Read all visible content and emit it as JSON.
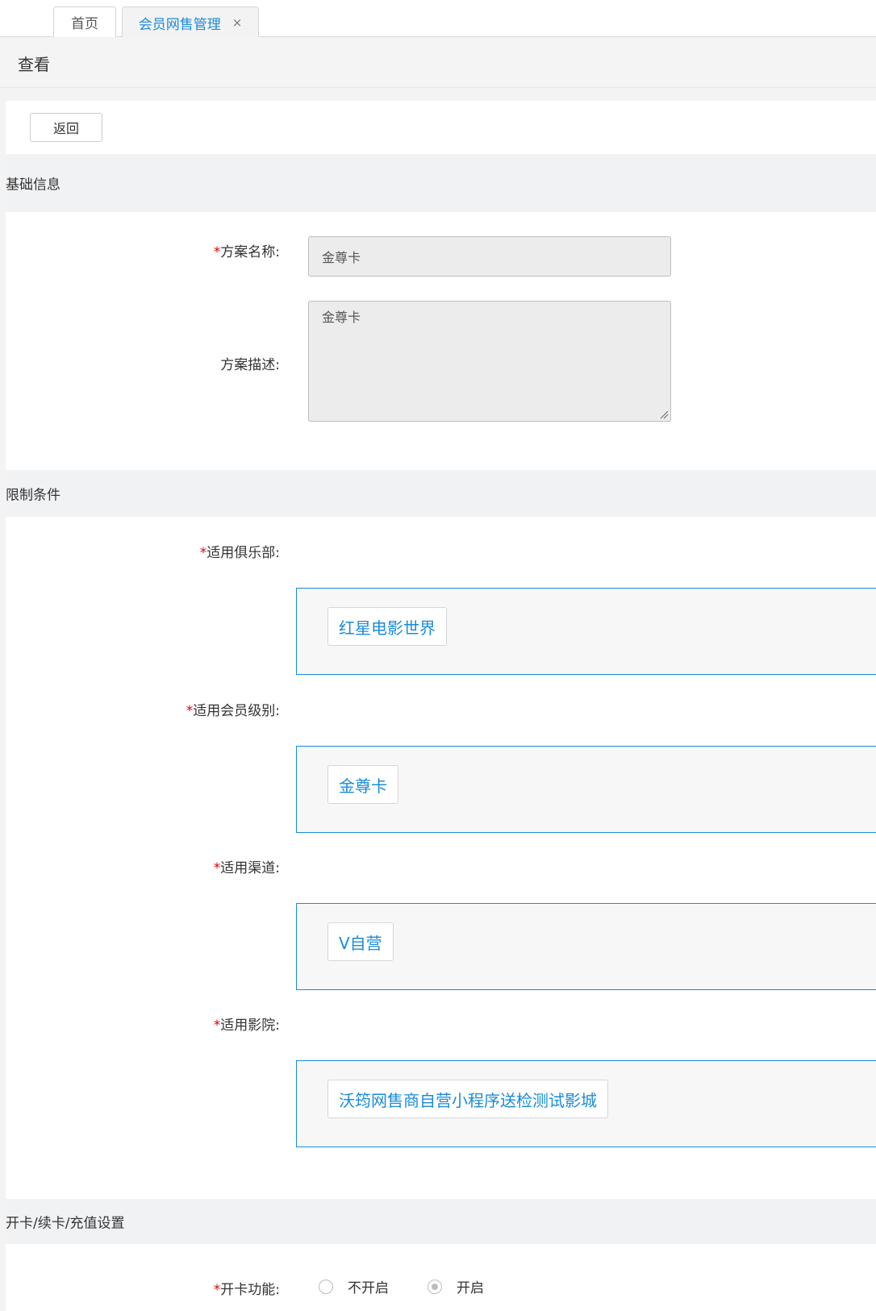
{
  "tabs": [
    {
      "label": "首页",
      "active": false
    },
    {
      "label": "会员网售管理",
      "active": true,
      "close": "×"
    }
  ],
  "page": {
    "title": "查看"
  },
  "toolbar": {
    "back_label": "返回"
  },
  "sections": {
    "basic": {
      "title": "基础信息",
      "plan_name": {
        "required_mark": "*",
        "label": "方案名称:",
        "value": "金尊卡"
      },
      "plan_desc": {
        "label": "方案描述:",
        "value": "金尊卡"
      }
    },
    "restrictions": {
      "title": "限制条件",
      "clubs": {
        "required_mark": "*",
        "label": "适用俱乐部:",
        "tags": [
          "红星电影世界"
        ]
      },
      "levels": {
        "required_mark": "*",
        "label": "适用会员级别:",
        "tags": [
          "金尊卡"
        ]
      },
      "channels": {
        "required_mark": "*",
        "label": "适用渠道:",
        "tags": [
          "V自营"
        ]
      },
      "cinemas": {
        "required_mark": "*",
        "label": "适用影院:",
        "tags": [
          "沃筠网售商自营小程序送检测试影城"
        ]
      }
    },
    "card_settings": {
      "title": "开卡/续卡/充值设置",
      "open_card": {
        "required_mark": "*",
        "label": "开卡功能:",
        "options": [
          {
            "label": "不开启",
            "checked": false
          },
          {
            "label": "开启",
            "checked": true
          }
        ]
      }
    }
  },
  "colors": {
    "accent": "#1a8cd8",
    "required": "#e40000",
    "section_bg": "#f1f2f4"
  }
}
